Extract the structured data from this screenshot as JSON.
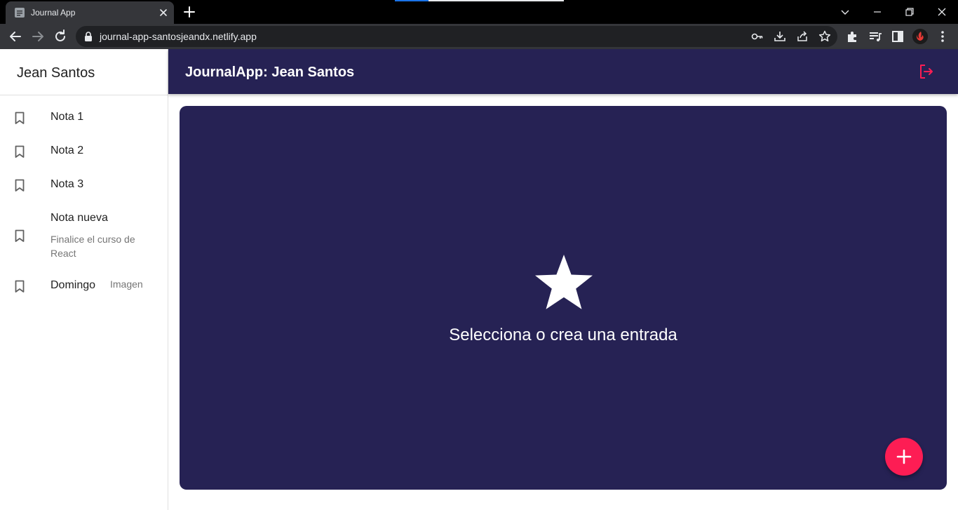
{
  "browser": {
    "tab_title": "Journal App",
    "url": "journal-app-santosjeandx.netlify.app"
  },
  "sidebar": {
    "user_name": "Jean Santos",
    "notes": [
      {
        "title": "Nota 1",
        "body": "",
        "aside": ""
      },
      {
        "title": "Nota 2",
        "body": "",
        "aside": ""
      },
      {
        "title": "Nota 3",
        "body": "",
        "aside": ""
      },
      {
        "title": "Nota nueva",
        "body": "Finalice el curso de React",
        "aside": ""
      },
      {
        "title": "Domingo",
        "body": "",
        "aside": "Imagen"
      }
    ]
  },
  "appbar": {
    "title": "JournalApp: Jean Santos"
  },
  "main": {
    "empty_message": "Selecciona o crea una entrada"
  },
  "icons": {
    "note": "bookmark-icon",
    "logout": "logout-icon",
    "empty_state": "star-icon",
    "fab": "plus-icon"
  },
  "colors": {
    "primary": "#262254",
    "accent": "#fd1d54",
    "text_light": "#ffffff"
  }
}
